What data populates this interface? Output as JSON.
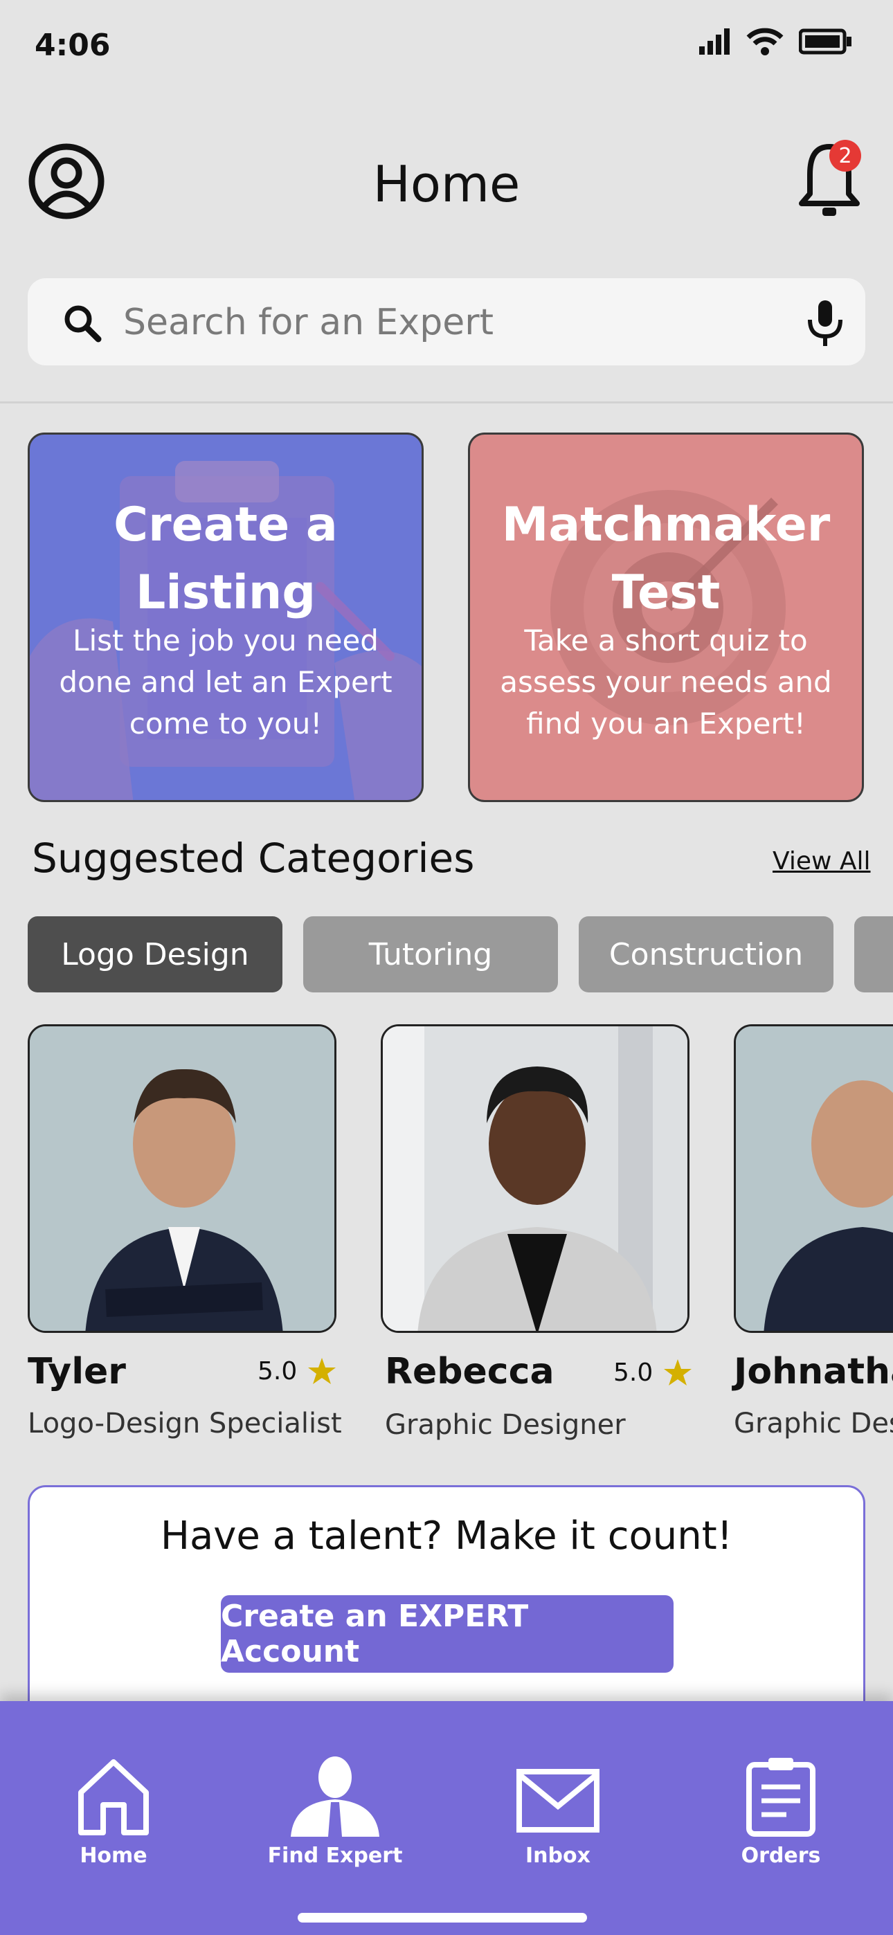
{
  "status_bar": {
    "time": "4:06"
  },
  "header": {
    "title": "Home",
    "notification_count": "2"
  },
  "search": {
    "placeholder": "Search for an Expert"
  },
  "cards": [
    {
      "title_line1": "Create a",
      "title_line2": "Listing",
      "description": "List the job you need done and let an Expert come to you!"
    },
    {
      "title_line1": "Matchmaker",
      "title_line2": "Test",
      "description": "Take a short quiz to assess your needs and find you an Expert!"
    }
  ],
  "categories": {
    "title": "Suggested Categories",
    "view_all": "View All",
    "items": [
      "Logo Design",
      "Tutoring",
      "Construction"
    ],
    "selected": "Logo Design"
  },
  "experts": [
    {
      "name": "Tyler",
      "rating": "5.0",
      "role": "Logo-Design Specialist"
    },
    {
      "name": "Rebecca",
      "rating": "5.0",
      "role": "Graphic Designer"
    },
    {
      "name": "Johnatha",
      "role": "Graphic Desi"
    }
  ],
  "promo": {
    "text": "Have a talent? Make it count!",
    "button": "Create an EXPERT Account"
  },
  "bottom_nav": [
    {
      "label": "Home",
      "icon": "home-icon"
    },
    {
      "label": "Find Expert",
      "icon": "person-icon"
    },
    {
      "label": "Inbox",
      "icon": "mail-icon"
    },
    {
      "label": "Orders",
      "icon": "clipboard-icon"
    }
  ],
  "colors": {
    "background": "#e4e4e4",
    "accent": "#776bd8",
    "card_blue": "#6b77d6",
    "card_red": "#db8b8b",
    "star": "#d4b000",
    "badge": "#e53935"
  }
}
